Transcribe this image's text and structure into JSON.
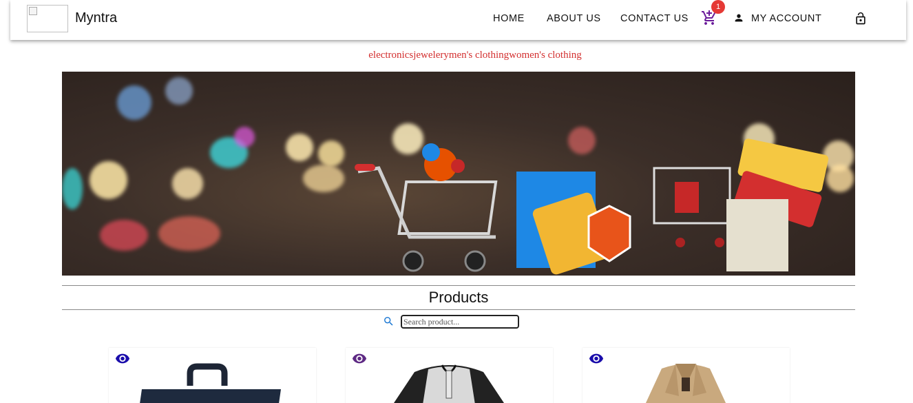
{
  "header": {
    "brand": "Myntra",
    "nav": {
      "home": "HOME",
      "about": "ABOUT US",
      "contact": "CONTACT US"
    },
    "cart_count": "1",
    "account_label": "MY ACCOUNT"
  },
  "categories": [
    "electronics",
    "jewelery",
    "men's clothing",
    "women's clothing"
  ],
  "products_section": {
    "title": "Products",
    "search_placeholder": "Search product..."
  },
  "colors": {
    "category_text": "#d32f2f",
    "cart_icon": "#6a1b9a",
    "badge": "#e53935",
    "search_icon": "#1976d2",
    "eye_icon_blue": "#1a0dab",
    "eye_icon_purple": "#5e2a84"
  },
  "icons": [
    "cart-icon",
    "account-icon",
    "lock-icon",
    "search-icon",
    "eye-icon"
  ],
  "products": [
    {
      "icon": "eye-icon",
      "thumb": "tote-bag"
    },
    {
      "icon": "eye-icon",
      "thumb": "raglan-shirt"
    },
    {
      "icon": "eye-icon",
      "thumb": "trench-coat"
    }
  ]
}
